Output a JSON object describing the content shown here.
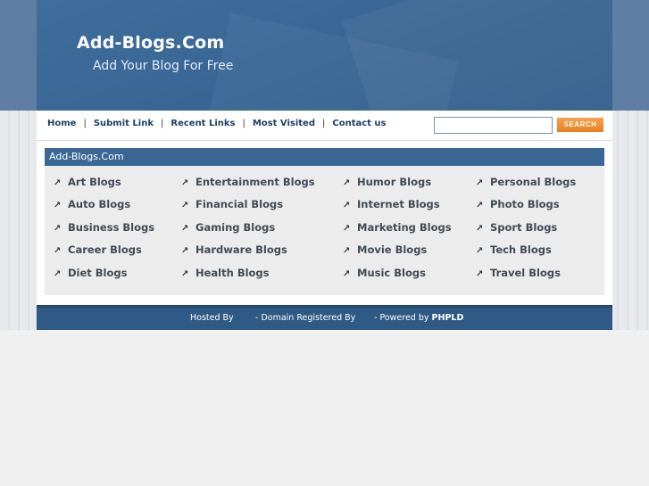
{
  "site": {
    "title": "Add-Blogs.Com",
    "slogan": "Add Your Blog For Free"
  },
  "nav": {
    "items": [
      "Home",
      "Submit Link",
      "Recent Links",
      "Most Visited",
      "Contact us"
    ],
    "separator": "|"
  },
  "search": {
    "placeholder": "",
    "button_label": "SEARCH"
  },
  "directory": {
    "title": "Add-Blogs.Com",
    "arrow_icon": "arrow-up-right-icon",
    "categories": [
      "Art Blogs",
      "Entertainment Blogs",
      "Humor Blogs",
      "Personal Blogs",
      "Auto Blogs",
      "Financial Blogs",
      "Internet Blogs",
      "Photo Blogs",
      "Business Blogs",
      "Gaming Blogs",
      "Marketing Blogs",
      "Sport Blogs",
      "Career Blogs",
      "Hardware Blogs",
      "Movie Blogs",
      "Tech Blogs",
      "Diet Blogs",
      "Health Blogs",
      "Music Blogs",
      "Travel Blogs"
    ]
  },
  "footer": {
    "hosted": "Hosted By",
    "domain": "- Domain Registered By",
    "powered_prefix": "- Powered by",
    "powered_name": "PHPLD"
  },
  "colors": {
    "header_blue": "#3a6896",
    "nav_text": "#1d3f66",
    "search_button": "#f08f2e",
    "box_title_bg": "#3a6794",
    "footer_bg": "#2f5a85"
  }
}
